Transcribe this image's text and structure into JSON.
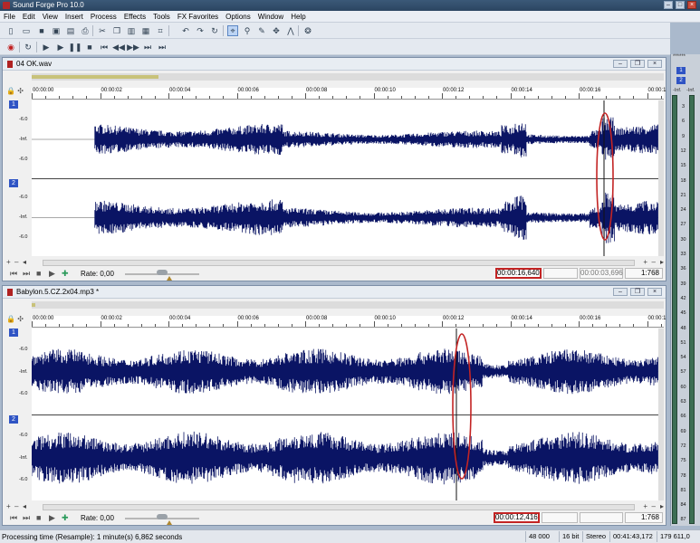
{
  "titlebar": {
    "title": "Sound Forge Pro 10.0"
  },
  "menu": [
    "File",
    "Edit",
    "View",
    "Insert",
    "Process",
    "Effects",
    "Tools",
    "FX Favorites",
    "Options",
    "Window",
    "Help"
  ],
  "ruler_labels": [
    "00:00:00",
    "00:00:02",
    "00:00:04",
    "00:00:06",
    "00:00:08",
    "00:00:10",
    "00:00:12",
    "00:00:14",
    "00:00:16",
    "00:00:1"
  ],
  "axis_labels": [
    "-6.0",
    "-Inf.",
    "-6.0"
  ],
  "documents": [
    {
      "name": "04 OK.wav",
      "rate_label": "Rate: 0,00",
      "cursor_time": "00:00:16,640",
      "selection_length": "00:00:03,696",
      "zoom_ratio": "1:768"
    },
    {
      "name": "Babylon.5.CZ.2x04.mp3 *",
      "rate_label": "Rate: 0,00",
      "cursor_time": "00:00:12,416",
      "selection_length": "",
      "zoom_ratio": "1:768"
    }
  ],
  "channels": [
    "1",
    "2"
  ],
  "meters": {
    "header": "******",
    "inf_left": "-Inf.",
    "inf_right": "-Inf.",
    "scale": [
      "3",
      "6",
      "9",
      "12",
      "15",
      "18",
      "21",
      "24",
      "27",
      "30",
      "33",
      "36",
      "39",
      "42",
      "45",
      "48",
      "51",
      "54",
      "57",
      "60",
      "63",
      "66",
      "69",
      "72",
      "75",
      "78",
      "81",
      "84",
      "87"
    ],
    "color": "#3c6e53"
  },
  "statusbar": {
    "message": "Processing time (Resample): 1 minute(s) 6,862 seconds",
    "sample_rate": "48 000 Hz",
    "bit_depth": "16 bit",
    "channels": "Stereo",
    "length": "00:41:43,172",
    "disk_space": "179 611,0 MB"
  },
  "colors": {
    "waveform": "#0a1464",
    "annotation": "#c32424",
    "accent": "#2f54c4"
  },
  "icons": {
    "toolbar1": [
      "new-icon",
      "open-icon",
      "save-icon",
      "save-all-icon",
      "render-icon",
      "print-icon",
      "cut-icon",
      "copy-icon",
      "paste-icon",
      "mix-icon",
      "crop-icon",
      "undo-icon",
      "redo-icon",
      "repeat-icon",
      "edit-tool-icon",
      "magnify-tool-icon",
      "pencil-tool-icon",
      "event-tool-icon",
      "envelope-tool-icon",
      "snap-icon"
    ],
    "toolbar2": [
      "record-icon",
      "loop-icon",
      "play-all-icon",
      "play-icon",
      "pause-icon",
      "stop-icon",
      "go-start-icon",
      "rewind-icon",
      "forward-icon",
      "go-end-icon",
      "end-icon"
    ]
  }
}
